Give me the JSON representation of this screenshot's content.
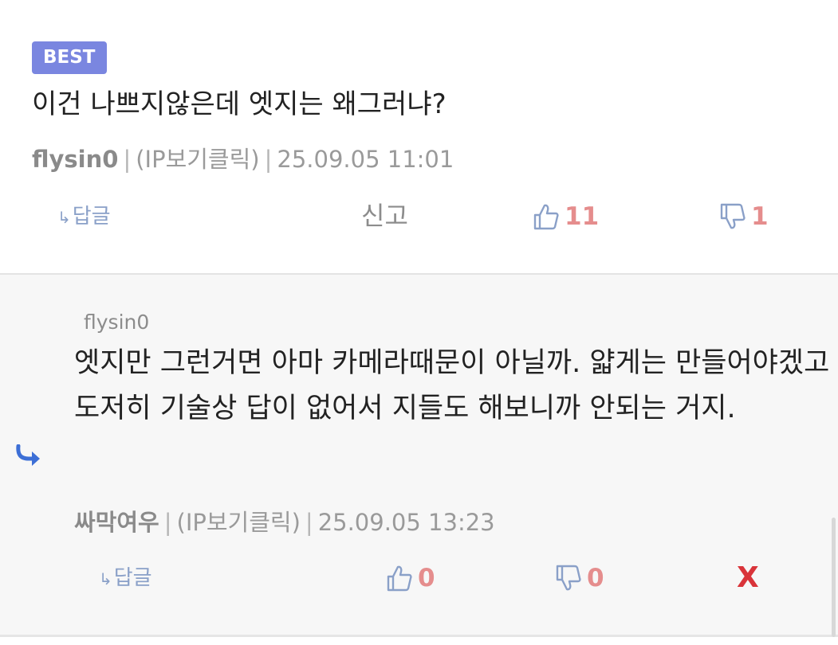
{
  "comment": {
    "badge": "BEST",
    "text": "이건 나쁘지않은데 엣지는 왜그러냐?",
    "author": "flysin0",
    "ip": "(IP보기클릭)",
    "date": "25.09.05 11:01",
    "reply_label": "답글",
    "report_label": "신고",
    "upvotes": "11",
    "downvotes": "1"
  },
  "reply": {
    "reply_to": "flysin0",
    "text": "엣지만 그런거면 아마 카메라때문이 아닐까. 얇게는 만들어야겠고 도저히 기술상 답이 없어서 지들도 해보니까 안되는 거지.",
    "author": "싸막여우",
    "ip": "(IP보기클릭)",
    "date": "25.09.05 13:23",
    "reply_label": "답글",
    "upvotes": "0",
    "downvotes": "0",
    "delete_label": "X"
  },
  "colors": {
    "badge_bg": "#7a86e0",
    "vote_count": "#e58d8d",
    "icon_blue": "#8aa0c8",
    "delete_red": "#d9343a",
    "reply_arrow": "#3d6fd6"
  },
  "icons": {
    "reply": "reply-arrow-icon",
    "upvote": "thumbs-up-icon",
    "downvote": "thumbs-down-icon",
    "nested_reply": "nested-reply-arrow-icon"
  }
}
